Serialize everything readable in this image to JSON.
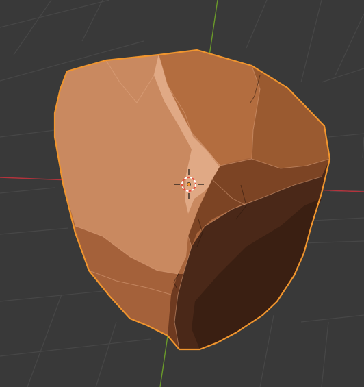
{
  "viewport": {
    "background": "#393939",
    "grid_color": "#474747",
    "axis_x_color": "#b4333c",
    "axis_y_color": "#6a9a2a",
    "selection_outline_color": "#f0952e",
    "cursor_colors": [
      "#e84a3a",
      "#ffffff"
    ],
    "object_colors": {
      "light": "#c98960",
      "mid": "#b06c40",
      "dark": "#4a2818",
      "darkest": "#351c10"
    }
  }
}
